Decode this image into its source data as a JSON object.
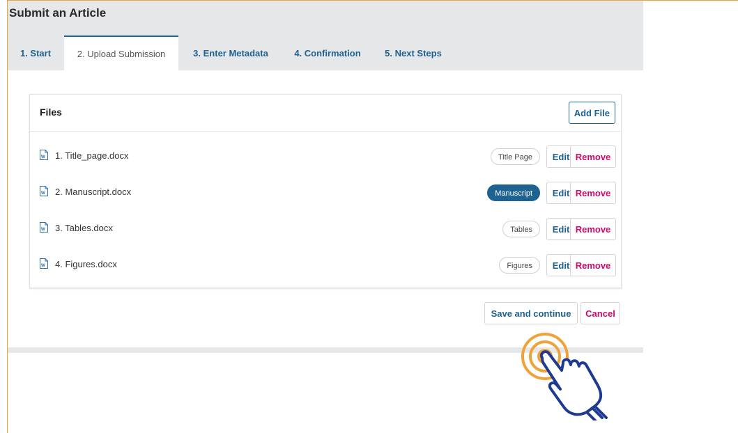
{
  "page": {
    "title": "Submit an Article"
  },
  "tabs": [
    {
      "label": "1. Start"
    },
    {
      "label": "2. Upload Submission",
      "active": true
    },
    {
      "label": "3. Enter Metadata"
    },
    {
      "label": "4. Confirmation"
    },
    {
      "label": "5. Next Steps"
    }
  ],
  "files": {
    "title": "Files",
    "add_label": "Add File",
    "items": [
      {
        "name": "1. Title_page.docx",
        "type": "Title Page",
        "selected": false
      },
      {
        "name": "2. Manuscript.docx",
        "type": "Manuscript",
        "selected": true
      },
      {
        "name": "3. Tables.docx",
        "type": "Tables",
        "selected": false
      },
      {
        "name": "4. Figures.docx",
        "type": "Figures",
        "selected": false
      }
    ],
    "edit_label": "Edit",
    "remove_label": "Remove"
  },
  "actions": {
    "save_label": "Save and continue",
    "cancel_label": "Cancel"
  },
  "colors": {
    "accent": "#1e6292",
    "danger": "#d00a6c",
    "highlight": "#f0a23a",
    "hand": "#1f3a93"
  },
  "icons": {
    "file": "word-document-icon",
    "pointer": "tap-hand-icon"
  }
}
